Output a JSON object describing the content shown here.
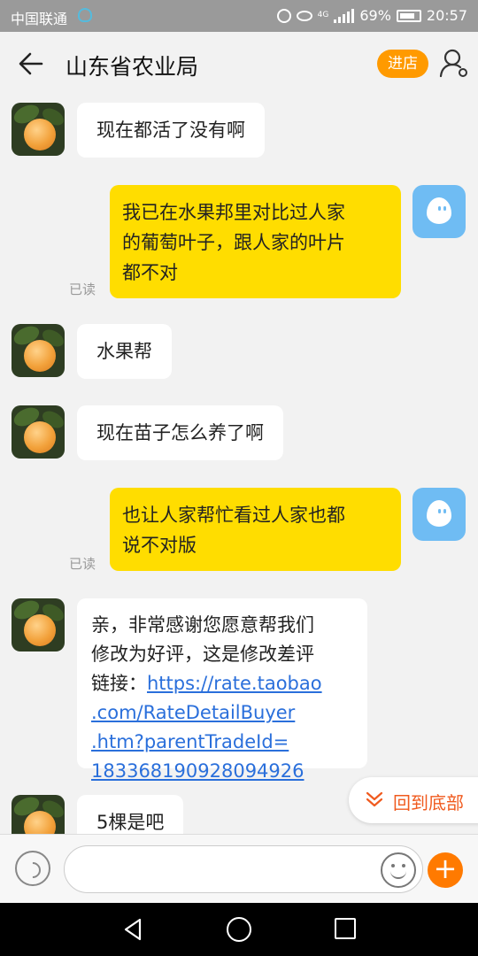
{
  "status_bar": {
    "carrier": "中国联通",
    "network": "4G",
    "battery": "69%",
    "time": "20:57"
  },
  "header": {
    "title": "山东省农业局",
    "shop_button": "进店"
  },
  "messages": [
    {
      "side": "left",
      "text": "现在都活了没有啊"
    },
    {
      "side": "right",
      "lines": [
        "我已在水果邦里对比过人家",
        "的葡萄叶子，跟人家的叶片",
        "都不对"
      ],
      "read": "已读"
    },
    {
      "side": "left",
      "text": "水果帮"
    },
    {
      "side": "left",
      "text": "现在苗子怎么养了啊"
    },
    {
      "side": "right",
      "lines": [
        "也让人家帮忙看过人家也都",
        "说不对版"
      ],
      "read": "已读"
    },
    {
      "side": "left",
      "lines": [
        "亲，非常感谢您愿意帮我们",
        "修改为好评，这是修改差评",
        "链接："
      ],
      "link_lines": [
        "https://rate.taobao",
        ".com/RateDetailBuyer",
        ".htm?parentTradeId=",
        "183368190928094926"
      ]
    },
    {
      "side": "left",
      "text": "5棵是吧"
    }
  ],
  "back_to_bottom": "回到底部",
  "input": {
    "placeholder": ""
  }
}
